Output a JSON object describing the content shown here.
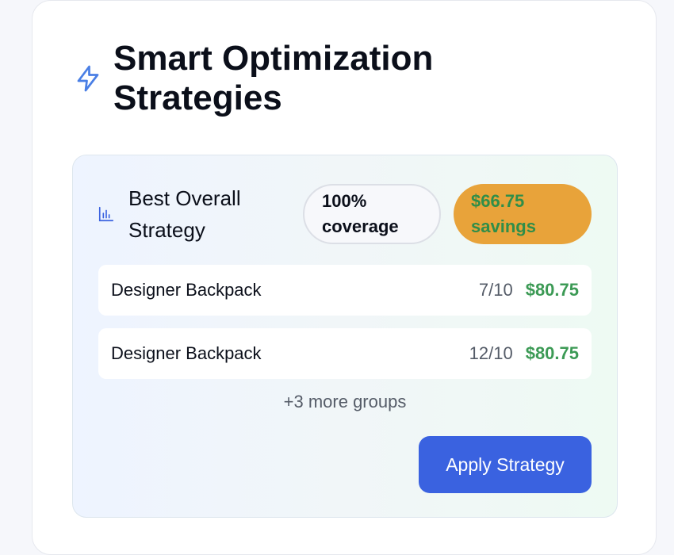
{
  "colors": {
    "accent_blue": "#3a62e0",
    "savings_orange": "#e8a33a",
    "money_green": "#3c9a55",
    "bolt_icon": "#4a7fe5"
  },
  "section": {
    "icon": "lightning-bolt-icon",
    "title": "Smart Optimization Strategies"
  },
  "strategy": {
    "icon": "bar-chart-icon",
    "title": "Best Overall Strategy",
    "coverage_badge": "100% coverage",
    "savings_badge": "$66.75 savings",
    "groups": [
      {
        "name": "Designer Backpack",
        "ratio": "7/10",
        "price": "$80.75"
      },
      {
        "name": "Designer Backpack",
        "ratio": "12/10",
        "price": "$80.75"
      }
    ],
    "more_text": "+3 more groups",
    "apply_label": "Apply Strategy"
  }
}
